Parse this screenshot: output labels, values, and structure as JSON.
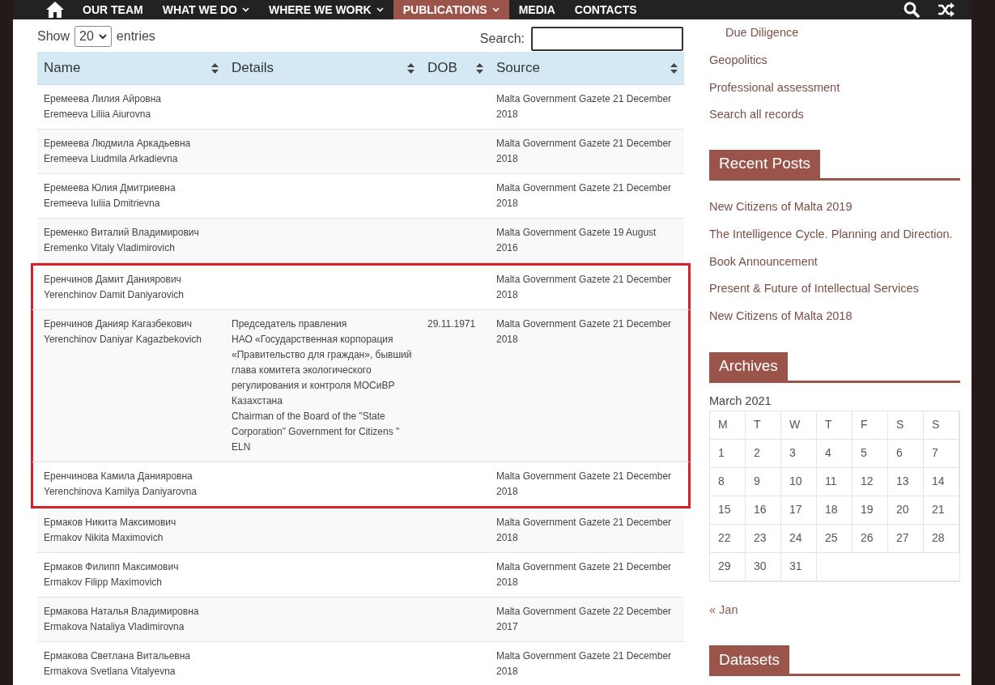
{
  "nav": {
    "items": [
      {
        "label": "OUR TEAM",
        "dropdown": false,
        "selected": false
      },
      {
        "label": "WHAT WE DO",
        "dropdown": true,
        "selected": false
      },
      {
        "label": "WHERE WE WORK",
        "dropdown": true,
        "selected": false
      },
      {
        "label": "PUBLICATIONS",
        "dropdown": true,
        "selected": true
      },
      {
        "label": "MEDIA",
        "dropdown": false,
        "selected": false
      },
      {
        "label": "CONTACTS",
        "dropdown": false,
        "selected": false
      }
    ]
  },
  "table_controls": {
    "show_label": "Show",
    "page_size": "20",
    "entries_label": "entries",
    "search_label": "Search:"
  },
  "table": {
    "columns": [
      {
        "label": "Name"
      },
      {
        "label": "Details"
      },
      {
        "label": "DOB"
      },
      {
        "label": "Source"
      }
    ],
    "rows": [
      {
        "name_ru": "Еремеева Лилия Айровна",
        "name_en": "Eremeeva Liliia Aiurovna",
        "details": [],
        "dob": "",
        "source": "Malta Government Gazete 21 December 2018",
        "highlighted": false
      },
      {
        "name_ru": "Еремеева Людмила Аркадьевна",
        "name_en": "Eremeeva Liudmila Arkadievna",
        "details": [],
        "dob": "",
        "source": "Malta Government Gazete 21 December 2018",
        "highlighted": false
      },
      {
        "name_ru": "Еремеева Юлия Дмитриевна",
        "name_en": "Eremeeva Iuliia Dmitrievna",
        "details": [],
        "dob": "",
        "source": "Malta Government Gazete 21 December 2018",
        "highlighted": false
      },
      {
        "name_ru": "Еременко Виталий Владимирович",
        "name_en": "Eremenko Vitaly Vladimirovich",
        "details": [],
        "dob": "",
        "source": "Malta Government Gazete 19 August 2016",
        "highlighted": false
      },
      {
        "name_ru": "Еренчинов Дамит Даниярович",
        "name_en": "Yerenchinov Damit Daniyarovich",
        "details": [],
        "dob": "",
        "source": "Malta Government Gazete 21 December 2018",
        "highlighted": true
      },
      {
        "name_ru": "Еренчинов Данияр Кагазбекович",
        "name_en": "Yerenchinov Daniyar Kagazbekovich",
        "details": [
          "Председатель правления",
          "НАО «Государственная корпорация «Правительство для граждан», бывший глава комитета экологического регулирования и контроля МОСиВР Казахстана",
          "Chairman of the Board of the \"State Corporation\" Government for Citizens \" ELN"
        ],
        "dob": "29.11.1971",
        "source": "Malta Government Gazete 21 December 2018",
        "highlighted": true
      },
      {
        "name_ru": "Еренчинова Камила Данияровна",
        "name_en": "Yerenchinova Kamilya Daniyarovna",
        "details": [],
        "dob": "",
        "source": "Malta Government Gazete 21 December 2018",
        "highlighted": true
      },
      {
        "name_ru": "Ермаков Никита Максимович",
        "name_en": "Ermakov Nikita Maximovich",
        "details": [],
        "dob": "",
        "source": "Malta Government Gazete 21 December 2018",
        "highlighted": false
      },
      {
        "name_ru": "Ермаков Филипп Максимович",
        "name_en": "Ermakov Filipp Maximovich",
        "details": [],
        "dob": "",
        "source": "Malta Government Gazete 21 December 2018",
        "highlighted": false
      },
      {
        "name_ru": "Ермакова Наталья Владимировна",
        "name_en": "Ermakova Nataliya Vladimirovna",
        "details": [],
        "dob": "",
        "source": "Malta Government Gazete 22 December 2017",
        "highlighted": false
      },
      {
        "name_ru": "Ермакова Светлана Витальевна",
        "name_en": "Ermakova Svetlana Vitalyevna",
        "details": [],
        "dob": "",
        "source": "Malta Government Gazete 21 December 2018",
        "highlighted": false
      }
    ]
  },
  "sidebar": {
    "category_links": [
      {
        "label": "Due Diligence",
        "kind": "sub"
      },
      {
        "label": "Geopolitics",
        "kind": "top"
      },
      {
        "label": "Professional assessment",
        "kind": "top"
      },
      {
        "label": "Search all records",
        "kind": "top"
      }
    ],
    "recent_posts": {
      "title": "Recent Posts",
      "items": [
        "New Citizens of Malta 2019",
        "The Intelligence Cycle. Planning and Direction.",
        "Book Announcement",
        "Present & Future of Intellectual Services",
        "New Citizens of Malta 2018"
      ]
    },
    "archives": {
      "title": "Archives",
      "calendar": {
        "caption": "March 2021",
        "weekdays": [
          "M",
          "T",
          "W",
          "T",
          "F",
          "S",
          "S"
        ],
        "weeks": [
          [
            "1",
            "2",
            "3",
            "4",
            "5",
            "6",
            "7"
          ],
          [
            "8",
            "9",
            "10",
            "11",
            "12",
            "13",
            "14"
          ],
          [
            "15",
            "16",
            "17",
            "18",
            "19",
            "20",
            "21"
          ],
          [
            "22",
            "23",
            "24",
            "25",
            "26",
            "27",
            "28"
          ],
          [
            "29",
            "30",
            "31"
          ]
        ]
      },
      "prev_link": "« Jan"
    },
    "datasets": {
      "title": "Datasets"
    }
  }
}
